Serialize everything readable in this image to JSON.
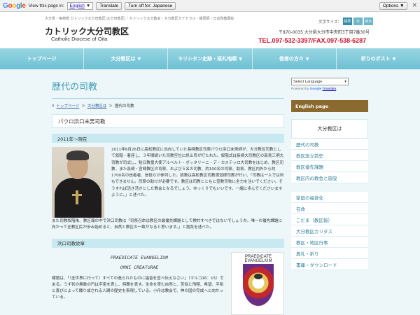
{
  "gbar": {
    "view_label": "View this page in:",
    "language": "English",
    "translate_label": "Translate",
    "turn_off_label": "Turn off for: Japanese",
    "options_label": "Options ▼",
    "close": "×"
  },
  "header": {
    "subline": "大分県・宮崎県 カトリック大分司教区(大分司教区)｜カトリック大分教会・大分教区カテドラル・朝原師・日出殉教顕彰",
    "title": "カトリック大分司教区",
    "subtitle": "Catholic Diocese of Oita",
    "font_size_label": "文字サイズ：",
    "font_sizes": [
      "標準",
      "大",
      "特大"
    ],
    "address": "〒870-0035 大分県大分市中央町3丁目7番30号",
    "tel": "TEL.097-532-3397/FAX.097-538-6287"
  },
  "nav": [
    "トップページ",
    "大分教区は",
    "キリシタン史跡・巡礼地順",
    "信者の方々",
    "祈りのポスト"
  ],
  "content": {
    "title": "歴代の司教",
    "breadcrumb": [
      "トップページ",
      "大分教区は",
      "歴代の司教"
    ],
    "name_box": "パウロ浜口末男司教",
    "band1": "2011年～現在",
    "bio": "2011年6月26日に高松教区に出向していた長崎教区司祭パウロ浜口末男師が、大分教区司教として叙階・着座し、３年間続いた司教空位に終止符が打たれた。叙階式は長崎大司教区の高見三明大司教が司式し、駐日教皇大使アルベルト・ボッタリ＝ニ・デ・カステッロ大司教をはじめ、教区司教、また長崎・宮崎教区の司祭、および５名の司教、約100名の司祭、助祭、教区内外から約1700名の信者者、信徒らが参列した。設教は高松教区司教満覚様司教が行い、「司教は一人では何もできません。司祭の助けが必要です。教区は司教とともに宣教司牧に全力を注いでください。そうすれば活き活きとした教会となるでしょう。ゆっくりでもいいです。一緒に歩んでくださいますように。」と述べた。",
    "bio_tail": "また司教叙階後、教区報の中で浜口司教は「司祭召命は教区の最優先課題として検討すべきではないでしょうか。唯一の優先課題に向かって全教区民が歩み始めると、自然と教区の一致がなると思います。」と抱負を述べた。",
    "band2": "浜口司教紋章",
    "motto1": "PRAEDICATE EVANGELIUM",
    "motto2": "OMNI CREATURAE",
    "crest_body": "標語は、「（全世界に行って）すべての造られたものに福音を宣べ伝えなさい」（マルコ16：15）である。うず状の無数の円は宇宙を表し、時間を表す。生命を育む自然と、苦悩と飛翔、希望、平和と喜びによって織り成される人間の歴史を表現している。小舟は教会で、神の国の完成へと向かっている。",
    "crest_title": "PRAEDICATE EVANGELIUM"
  },
  "side": {
    "lang_select": "Select Language",
    "powered_by": "Powered by",
    "google": "Google",
    "translate": "Translate",
    "english_page": "English page",
    "section_head": "大分教区は",
    "items1": [
      "歴代の司教",
      "教区設立前史",
      "教区優先課題",
      "教区内の教会と施設"
    ],
    "items2": [
      "家庭の福音化",
      "召命",
      "こだま（教区報）",
      "大分教区カリタス",
      "教区・地区行事",
      "典礼・祈り",
      "書庫・ダウンロード"
    ]
  }
}
